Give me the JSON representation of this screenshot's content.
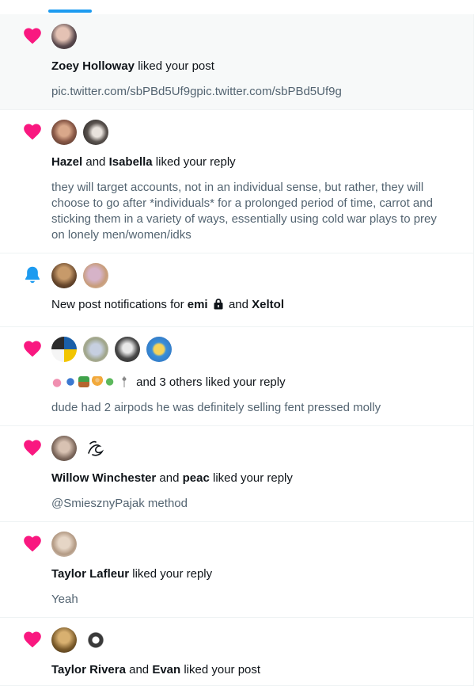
{
  "colors": {
    "like": "#f91880",
    "bell": "#1d9bf0",
    "tab_indicator": "#1d9bf0",
    "muted_text": "#536471"
  },
  "notifications": [
    {
      "type": "like",
      "icon": "heart-icon",
      "unread": true,
      "actors": [
        "Zoey Holloway"
      ],
      "action": " liked your post",
      "content": "pic.twitter.com/sbPBd5Uf9gpic.twitter.com/sbPBd5Uf9g"
    },
    {
      "type": "like",
      "icon": "heart-icon",
      "actors": [
        "Hazel",
        "Isabella"
      ],
      "joiner": " and ",
      "action": " liked your reply",
      "content": "they will target accounts, not in an individual sense, but rather, they will choose to go after *individuals* for a prolonged period of time, carrot and sticking them in a variety of ways, essentially using cold war plays to prey on lonely men/women/idks"
    },
    {
      "type": "new-post",
      "icon": "bell-icon",
      "prefix": "New post notifications for ",
      "actors": [
        "emi",
        "Xeltol"
      ],
      "joiner": " and "
    },
    {
      "type": "like",
      "icon": "heart-icon",
      "actor_emoji": [
        "lotus-emoji",
        "hamsa-emoji",
        "plant-emoji",
        "meditation-emoji",
        "herb-emoji",
        "person-emoji"
      ],
      "action": " and 3 others liked your reply",
      "content": "dude had 2 airpods he was definitely selling fent pressed molly"
    },
    {
      "type": "like",
      "icon": "heart-icon",
      "actors": [
        "Willow Winchester",
        "peac"
      ],
      "joiner": " and ",
      "action": " liked your reply",
      "content": "@SmiesznyPajak method"
    },
    {
      "type": "like",
      "icon": "heart-icon",
      "actors": [
        "Taylor Lafleur"
      ],
      "action": " liked your reply",
      "content": "Yeah"
    },
    {
      "type": "like",
      "icon": "heart-icon",
      "actors": [
        "Taylor Rivera",
        "Evan"
      ],
      "joiner": " and ",
      "action": " liked your post"
    }
  ]
}
